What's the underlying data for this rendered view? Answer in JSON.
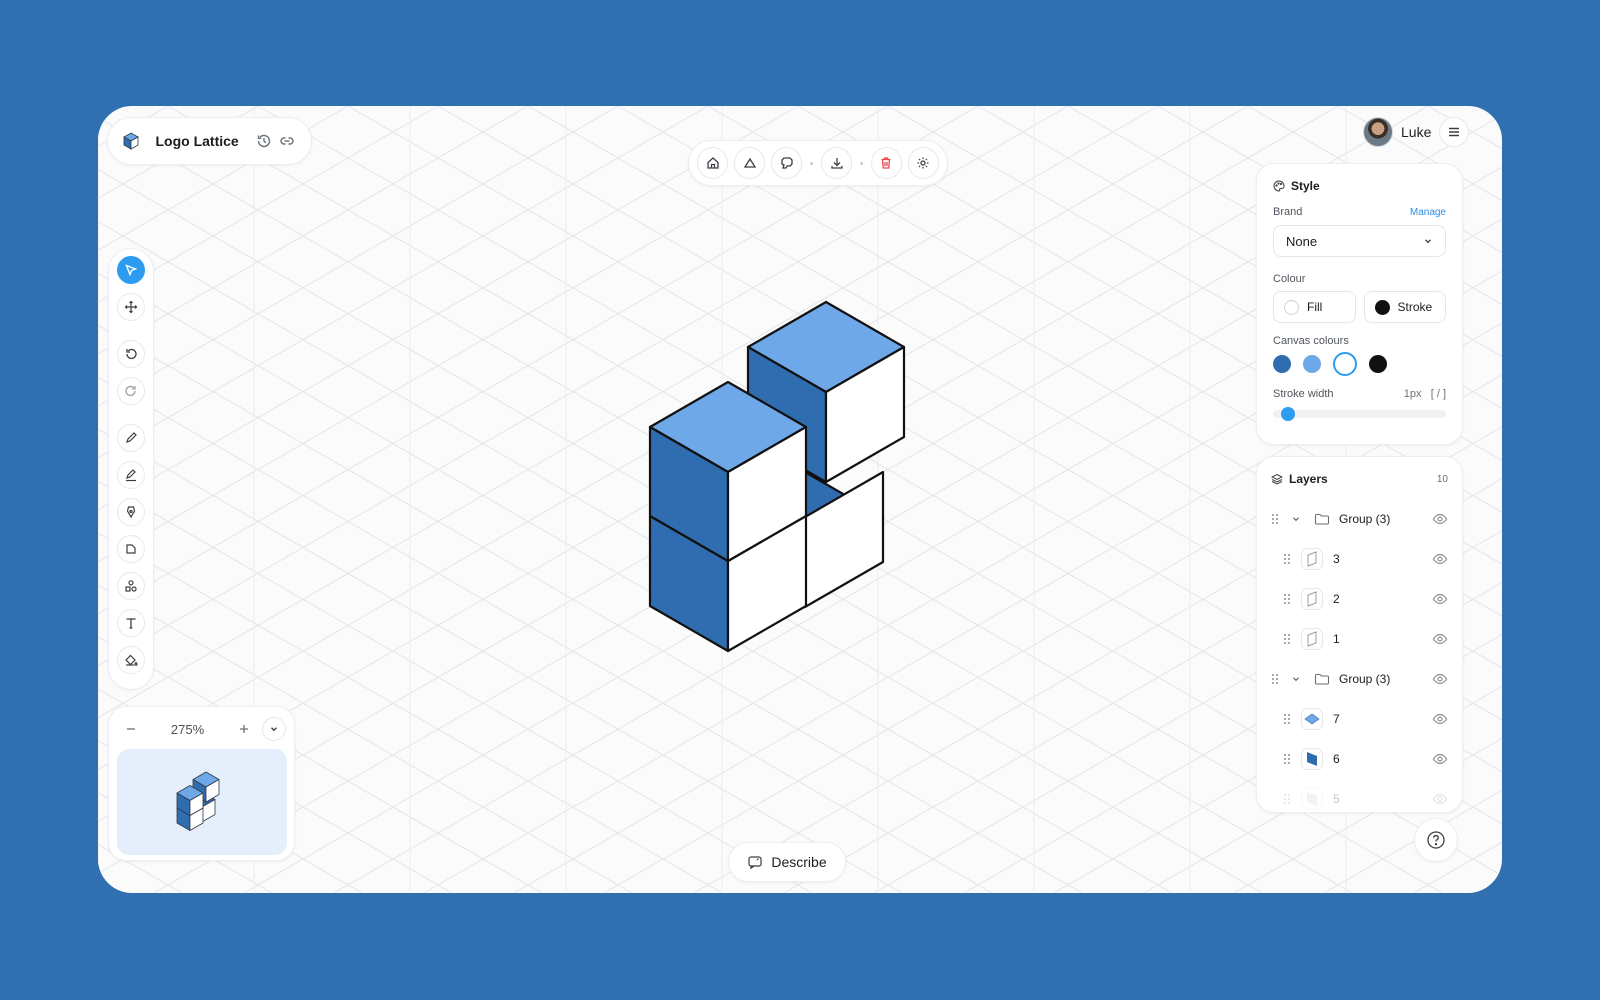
{
  "project": {
    "title": "Logo Lattice"
  },
  "user": {
    "name": "Luke"
  },
  "zoom": {
    "level": "275%"
  },
  "describe": {
    "label": "Describe"
  },
  "style_panel": {
    "title": "Style",
    "brand_label": "Brand",
    "manage_label": "Manage",
    "brand_value": "None",
    "colour_label": "Colour",
    "fill_label": "Fill",
    "stroke_label": "Stroke",
    "fill_color": "#ffffff",
    "stroke_color": "#111111",
    "canvas_colours_label": "Canvas colours",
    "canvas_colours": [
      "#2f6db0",
      "#6fa8e8",
      "#ffffff",
      "#111111"
    ],
    "selected_canvas_colour": "#ffffff",
    "stroke_width_label": "Stroke width",
    "stroke_width_value": "1px",
    "stroke_width_shortcut": "[ / ]",
    "stroke_width_level": 0.02
  },
  "layers_panel": {
    "title": "Layers",
    "count": "10",
    "items": [
      {
        "label": "Group (3)",
        "type": "group",
        "expanded": true
      },
      {
        "label": "3",
        "type": "shape",
        "thumb": "outline"
      },
      {
        "label": "2",
        "type": "shape",
        "thumb": "outline"
      },
      {
        "label": "1",
        "type": "shape",
        "thumb": "outline"
      },
      {
        "label": "Group (3)",
        "type": "group",
        "expanded": true
      },
      {
        "label": "7",
        "type": "shape",
        "thumb": "light-blue-top"
      },
      {
        "label": "6",
        "type": "shape",
        "thumb": "dark-blue-side"
      },
      {
        "label": "5",
        "type": "shape",
        "thumb": "faded"
      }
    ]
  },
  "colors": {
    "accent": "#2d9cf0",
    "cube_top": "#6fa8e8",
    "cube_left": "#2f6db0",
    "cube_right": "#ffffff",
    "background": "#3170b0"
  },
  "icons": {
    "top_toolbar": [
      "home-icon",
      "cloud-icon",
      "paint-icon",
      "download-icon",
      "trash-icon",
      "settings-icon"
    ],
    "tools": [
      "select-icon",
      "move-icon",
      "undo-icon",
      "redo-icon",
      "pencil-icon",
      "pen-icon",
      "nib-icon",
      "shape-icon",
      "components-icon",
      "text-icon",
      "fill-bucket-icon"
    ]
  }
}
